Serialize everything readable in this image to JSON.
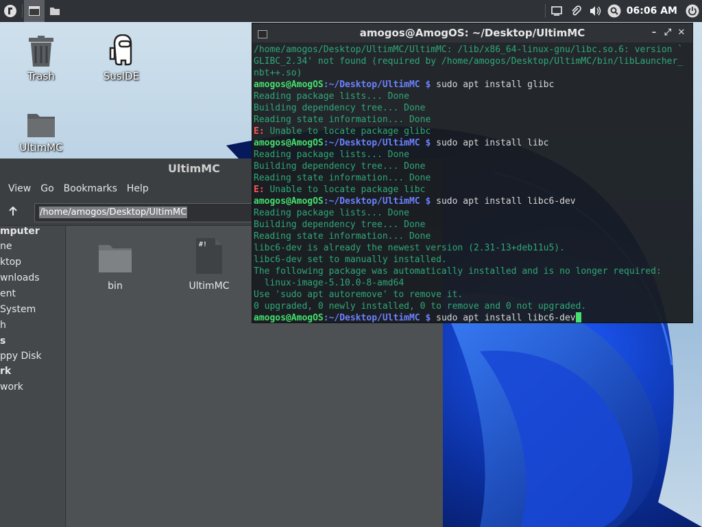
{
  "panel": {
    "clock": "06:06 AM",
    "icons": [
      "os-menu-icon",
      "terminal-task-icon",
      "folder-task-icon",
      "display-icon",
      "clip-icon",
      "volume-icon",
      "search-icon",
      "power-icon"
    ]
  },
  "desktop": {
    "icons": [
      {
        "label": "Trash",
        "icon": "trash-icon"
      },
      {
        "label": "SusIDE",
        "icon": "amogus-icon"
      },
      {
        "label": "UltimMC",
        "icon": "folder-icon"
      }
    ]
  },
  "file_manager": {
    "title": "UltimMC",
    "menu": [
      "View",
      "Go",
      "Bookmarks",
      "Help"
    ],
    "path": "/home/amogos/Desktop/UltimMC",
    "sidebar": [
      {
        "label": "mputer",
        "header": true
      },
      {
        "label": "ne",
        "header": false
      },
      {
        "label": "ktop",
        "header": false
      },
      {
        "label": "wnloads",
        "header": false
      },
      {
        "label": "ent",
        "header": false
      },
      {
        "label": "System",
        "header": false
      },
      {
        "label": "h",
        "header": false
      },
      {
        "label": "s",
        "header": true
      },
      {
        "label": "ppy Disk",
        "header": false
      },
      {
        "label": "rk",
        "header": true
      },
      {
        "label": "work",
        "header": false
      }
    ],
    "files": [
      {
        "label": "bin",
        "icon": "folder-icon"
      },
      {
        "label": "UltimMC",
        "icon": "executable-file-icon"
      }
    ]
  },
  "terminal": {
    "title": "amogos@AmogOS: ~/Desktop/UltimMC",
    "prompt_user": "amogos@AmogOS",
    "prompt_path": ":~/Desktop/UltimMC $",
    "lines": [
      {
        "type": "out",
        "text": "/home/amogos/Desktop/UltimMC/UltimMC: /lib/x86_64-linux-gnu/libc.so.6: version `"
      },
      {
        "type": "out",
        "text": "GLIBC_2.34' not found (required by /home/amogos/Desktop/UltimMC/bin/libLauncher_"
      },
      {
        "type": "out",
        "text": "nbt++.so)"
      },
      {
        "type": "prompt",
        "text": " sudo apt install glibc"
      },
      {
        "type": "out",
        "text": "Reading package lists... Done"
      },
      {
        "type": "out",
        "text": "Building dependency tree... Done"
      },
      {
        "type": "out",
        "text": "Reading state information... Done"
      },
      {
        "type": "err",
        "label": "E:",
        "text": " Unable to locate package glibc"
      },
      {
        "type": "prompt",
        "text": " sudo apt install libc"
      },
      {
        "type": "out",
        "text": "Reading package lists... Done"
      },
      {
        "type": "out",
        "text": "Building dependency tree... Done"
      },
      {
        "type": "out",
        "text": "Reading state information... Done"
      },
      {
        "type": "err",
        "label": "E:",
        "text": " Unable to locate package libc"
      },
      {
        "type": "prompt",
        "text": " sudo apt install libc6-dev"
      },
      {
        "type": "out",
        "text": "Reading package lists... Done"
      },
      {
        "type": "out",
        "text": "Building dependency tree... Done"
      },
      {
        "type": "out",
        "text": "Reading state information... Done"
      },
      {
        "type": "out",
        "text": "libc6-dev is already the newest version (2.31-13+deb11u5)."
      },
      {
        "type": "out",
        "text": "libc6-dev set to manually installed."
      },
      {
        "type": "out",
        "text": "The following package was automatically installed and is no longer required:"
      },
      {
        "type": "out",
        "text": "  linux-image-5.10.0-8-amd64"
      },
      {
        "type": "out",
        "text": "Use 'sudo apt autoremove' to remove it."
      },
      {
        "type": "out",
        "text": "0 upgraded, 0 newly installed, 0 to remove and 0 not upgraded."
      },
      {
        "type": "current",
        "text": " sudo apt install libc6-dev"
      }
    ]
  },
  "colors": {
    "output": "#2fa876",
    "prompt_user": "#45e06d",
    "prompt_path": "#6b82ff",
    "error": "#ff5555",
    "panel": "#2f3337"
  }
}
